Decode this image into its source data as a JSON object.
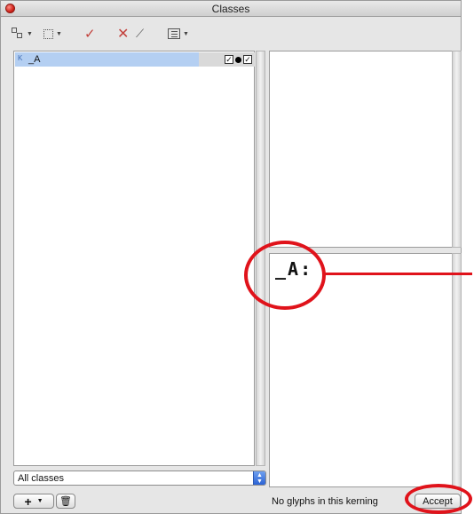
{
  "window": {
    "title": "Classes"
  },
  "toolbar": {
    "items": [
      {
        "icon": "class-layout-icon"
      },
      {
        "icon": "selection-box-icon"
      },
      {
        "icon": "checkmark-icon"
      },
      {
        "icon": "delete-x-icon"
      },
      {
        "icon": "magic-wand-icon"
      },
      {
        "icon": "table-view-icon"
      }
    ]
  },
  "class_list": {
    "rows": [
      {
        "kind_icon": "kerning-class-icon",
        "name": "_A",
        "checked_left": "✓",
        "checked_right": "✓"
      }
    ]
  },
  "preview": {
    "kern_text": "_A:"
  },
  "footer": {
    "filter_value": "All classes",
    "add_label": "+",
    "status": "No glyphs in this kerning",
    "accept_label": "Accept"
  },
  "colors": {
    "annotation": "#e0131b",
    "selection": "#b4cff2",
    "accent": "#2c63d4"
  }
}
